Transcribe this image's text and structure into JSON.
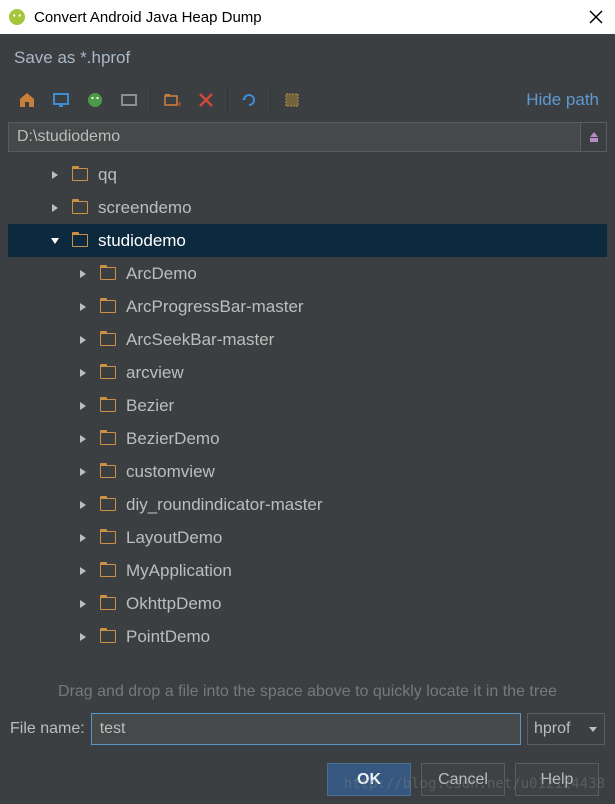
{
  "window": {
    "title": "Convert Android Java Heap Dump"
  },
  "subtitle": "Save as *.hprof",
  "toolbar": {
    "hide_path": "Hide path"
  },
  "path": "D:\\studiodemo",
  "tree": {
    "items": [
      {
        "label": "qq",
        "expanded": false,
        "level": 0,
        "selected": false
      },
      {
        "label": "screendemo",
        "expanded": false,
        "level": 0,
        "selected": false
      },
      {
        "label": "studiodemo",
        "expanded": true,
        "level": 0,
        "selected": true
      },
      {
        "label": "ArcDemo",
        "expanded": false,
        "level": 1,
        "selected": false
      },
      {
        "label": "ArcProgressBar-master",
        "expanded": false,
        "level": 1,
        "selected": false
      },
      {
        "label": "ArcSeekBar-master",
        "expanded": false,
        "level": 1,
        "selected": false
      },
      {
        "label": "arcview",
        "expanded": false,
        "level": 1,
        "selected": false
      },
      {
        "label": "Bezier",
        "expanded": false,
        "level": 1,
        "selected": false
      },
      {
        "label": "BezierDemo",
        "expanded": false,
        "level": 1,
        "selected": false
      },
      {
        "label": "customview",
        "expanded": false,
        "level": 1,
        "selected": false
      },
      {
        "label": "diy_roundindicator-master",
        "expanded": false,
        "level": 1,
        "selected": false
      },
      {
        "label": "LayoutDemo",
        "expanded": false,
        "level": 1,
        "selected": false
      },
      {
        "label": "MyApplication",
        "expanded": false,
        "level": 1,
        "selected": false
      },
      {
        "label": "OkhttpDemo",
        "expanded": false,
        "level": 1,
        "selected": false
      },
      {
        "label": "PointDemo",
        "expanded": false,
        "level": 1,
        "selected": false
      }
    ]
  },
  "hint": "Drag and drop a file into the space above to quickly locate it in the tree",
  "filename": {
    "label": "File name:",
    "value": "test",
    "ext": "hprof"
  },
  "buttons": {
    "ok": "OK",
    "cancel": "Cancel",
    "help": "Help"
  },
  "watermark": "http://blog.csdn.net/u012124438"
}
